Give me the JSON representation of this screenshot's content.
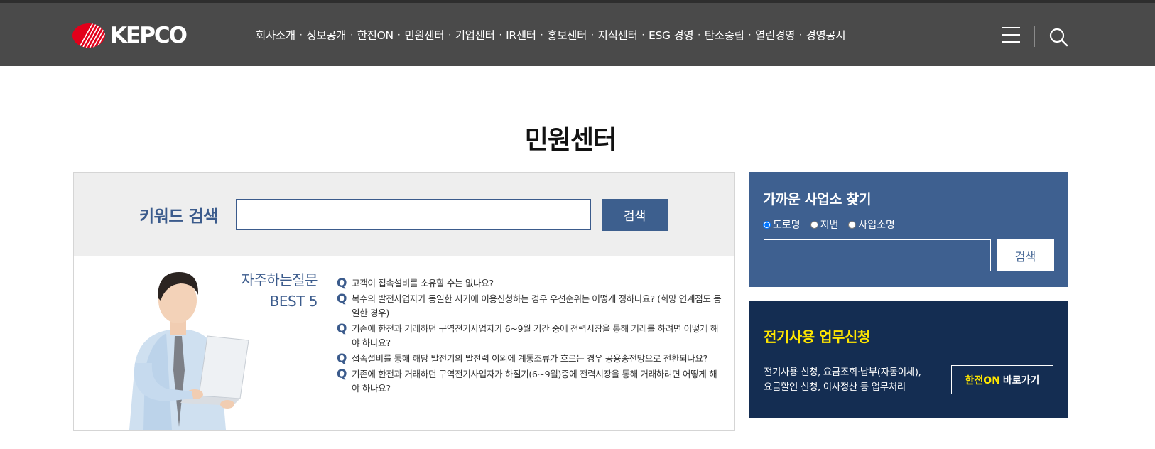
{
  "header": {
    "logo_text": "KEPCO",
    "nav": [
      "회사소개",
      "정보공개",
      "한전ON",
      "민원센터",
      "기업센터",
      "IR센터",
      "홍보센터",
      "지식센터",
      "ESG 경영",
      "탄소중립",
      "열린경영",
      "경영공시"
    ],
    "separator": "·",
    "icons": [
      "hamburger-menu-icon",
      "search-icon"
    ]
  },
  "page": {
    "title": "민원센터"
  },
  "keyword_search": {
    "label": "키워드 검색",
    "input_value": "",
    "button_label": "검색"
  },
  "faq": {
    "heading_line1": "자주하는질문",
    "heading_line2": "BEST 5",
    "marker": "Q",
    "items": [
      "고객이 접속설비를 소유할 수는 없나요?",
      "복수의 발전사업자가 동일한 시기에 이용신청하는 경우 우선순위는 어떻게 정하나요? (희망 연계점도 동일한 경우)",
      "기존에 한전과 거래하던 구역전기사업자가 6~9월 기간 중에 전력시장을 통해 거래를 하려면 어떻게 해야 하나요?",
      "접속설비를 통해 해당 발전기의 발전력 이외에 계통조류가 흐르는 경우 공용송전망으로 전환되나요?",
      "기존에 한전과 거래하던 구역전기사업자가 하절기(6~9월)중에 전력시장을 통해 거래하려면 어떻게 해야 하나요?"
    ]
  },
  "nearby_office": {
    "title": "가까운 사업소 찾기",
    "options": [
      "도로명",
      "지번",
      "사업소명"
    ],
    "selected_option": "도로명",
    "input_value": "",
    "button_label": "검색"
  },
  "electric_service": {
    "title": "전기사용 업무신청",
    "desc_line1": "전기사용 신청, 요금조회·납부(자동이체),",
    "desc_line2": "요금할인 신청, 이사정산 등 업무처리",
    "button_highlight": "한전ON",
    "button_rest": "바로가기"
  },
  "colors": {
    "header_bg": "#4a4a4a",
    "accent_blue": "#3e6090",
    "navy": "#142d52",
    "yellow": "#ffe600",
    "logo_red": "#e2001a"
  }
}
